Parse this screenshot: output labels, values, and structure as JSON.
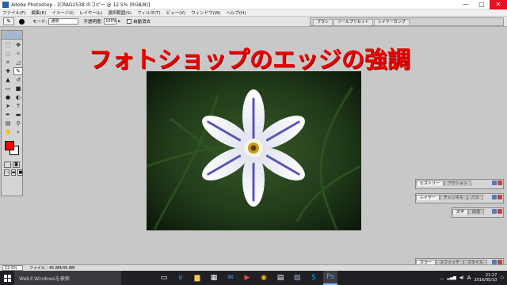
{
  "window": {
    "title": "Adobe Photoshop - [CRAG2538 のコピー @ 12.5% (RGB/8)]",
    "min": "—",
    "max": "□",
    "close": "✕"
  },
  "menu": [
    "ファイル(F)",
    "編集(E)",
    "イメージ(I)",
    "レイヤー(L)",
    "選択範囲(S)",
    "フィルタ(T)",
    "ビュー(V)",
    "ウィンドウ(W)",
    "ヘルプ(H)"
  ],
  "options": {
    "mode_label": "モード:",
    "mode_value": "通常",
    "opacity_label": "不透明度:",
    "opacity_value": "100%",
    "auto_erase_label": "自動消去"
  },
  "palette_well": [
    "ブラシ",
    "ツールプリセット",
    "レイヤーカンプ"
  ],
  "heading": "フォトショップのエッジの強調",
  "status": {
    "zoom": "12.5%",
    "file_info": "ファイル : 45.8M/45.8M"
  },
  "panels": {
    "history": [
      "ヒストリー",
      "アクション"
    ],
    "layers": [
      "レイヤー",
      "チャンネル",
      "パス"
    ],
    "character": [
      "文字",
      "段落"
    ],
    "color": [
      "カラー",
      "スウォッチ",
      "スタイル"
    ]
  },
  "taskbar": {
    "search_placeholder": "WebとWindowsを検索",
    "time": "21:27",
    "date": "2016/05/10",
    "ime": "A"
  },
  "colors": {
    "foreground": "#ff0000",
    "background": "#ffffff",
    "heading": "#ee0000"
  }
}
